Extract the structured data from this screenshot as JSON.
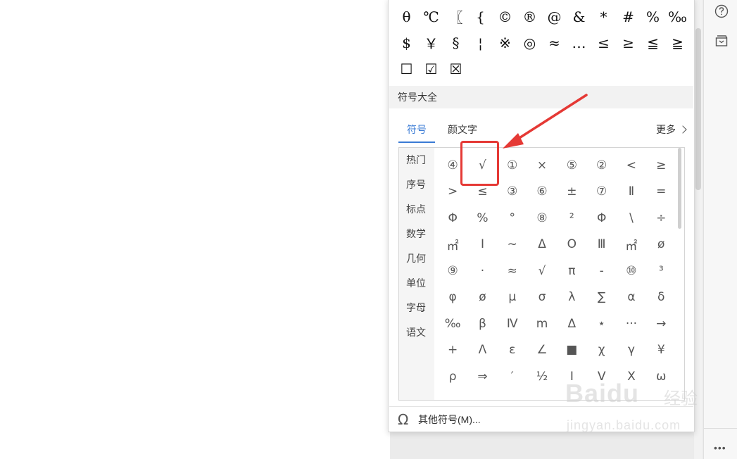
{
  "recent_symbols": [
    [
      "θ",
      "℃",
      "〖",
      "{",
      "©",
      "®",
      "@",
      "&",
      "*",
      "#",
      "%",
      "‰"
    ],
    [
      "$",
      "￥",
      "§",
      "¦",
      "※",
      "◎",
      "≈",
      "…",
      "≤",
      "≥",
      "≦",
      "≧"
    ],
    [
      "☐",
      "☑",
      "☒"
    ]
  ],
  "section_title": "符号大全",
  "tabs": {
    "active": "符号",
    "second": "颜文字",
    "more": "更多"
  },
  "categories": [
    "热门",
    "序号",
    "标点",
    "数学",
    "几何",
    "单位",
    "字母",
    "语文"
  ],
  "symbol_grid": [
    [
      "④",
      "√",
      "①",
      "×",
      "⑤",
      "②",
      "<",
      "≥"
    ],
    [
      ">",
      "≤",
      "③",
      "⑥",
      "±",
      "⑦",
      "Ⅱ",
      "="
    ],
    [
      "Φ",
      "%",
      "°",
      "⑧",
      "²",
      "Φ",
      "\\",
      "÷"
    ],
    [
      "㎡",
      "Ⅰ",
      "~",
      "Δ",
      "O",
      "Ⅲ",
      "㎡",
      "ø"
    ],
    [
      "⑨",
      "·",
      "≈",
      "√",
      "π",
      "-",
      "⑩",
      "³"
    ],
    [
      "φ",
      "ø",
      "μ",
      "σ",
      "λ",
      "∑",
      "α",
      "δ"
    ],
    [
      "‰",
      "β",
      "Ⅳ",
      "m",
      "Δ",
      "⋆",
      "···",
      "→"
    ],
    [
      "+",
      "Λ",
      "ε",
      "∠",
      "■",
      "χ",
      "γ",
      "¥"
    ],
    [
      "ρ",
      "⇒",
      "′",
      "½",
      "Ⅰ",
      "Ⅴ",
      "Χ",
      "ω"
    ]
  ],
  "footer": {
    "icon": "omega-icon",
    "label": "其他符号(M)..."
  },
  "watermark": {
    "logo": "Baidu",
    "cn": "经验",
    "url": "jingyan.baidu.com"
  },
  "accent_color": "#3a7bd5",
  "highlight_color": "#e53935"
}
